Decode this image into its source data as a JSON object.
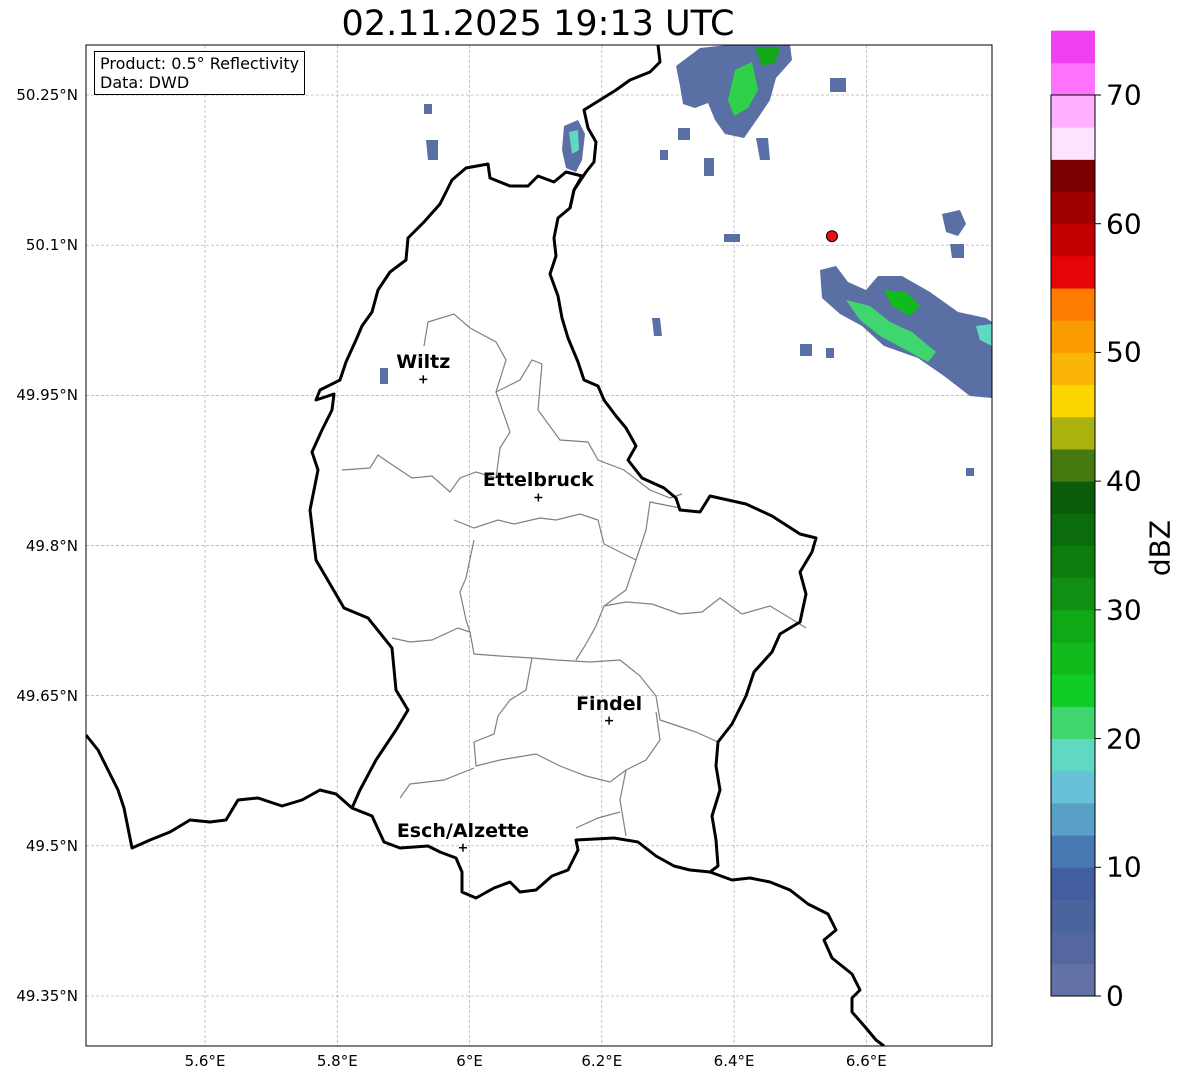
{
  "title": "02.11.2025 19:13 UTC",
  "info_box": {
    "product": "Product: 0.5° Reflectivity",
    "data": "Data: DWD"
  },
  "lat_ticks": [
    {
      "lat": 50.25,
      "label": "50.25°N"
    },
    {
      "lat": 50.1,
      "label": "50.1°N"
    },
    {
      "lat": 49.95,
      "label": "49.95°N"
    },
    {
      "lat": 49.8,
      "label": "49.8°N"
    },
    {
      "lat": 49.65,
      "label": "49.65°N"
    },
    {
      "lat": 49.5,
      "label": "49.5°N"
    },
    {
      "lat": 49.35,
      "label": "49.35°N"
    }
  ],
  "lon_ticks": [
    {
      "lon": 5.6,
      "label": "5.6°E"
    },
    {
      "lon": 5.8,
      "label": "5.8°E"
    },
    {
      "lon": 6.0,
      "label": "6°E"
    },
    {
      "lon": 6.2,
      "label": "6.2°E"
    },
    {
      "lon": 6.4,
      "label": "6.4°E"
    },
    {
      "lon": 6.6,
      "label": "6.6°E"
    }
  ],
  "extent": {
    "lon_min": 5.42,
    "lon_max": 6.79,
    "lat_min": 49.3,
    "lat_max": 50.3
  },
  "cities": [
    {
      "name": "Wiltz",
      "lon": 5.93,
      "lat": 49.966
    },
    {
      "name": "Ettelbruck",
      "lon": 6.104,
      "lat": 49.848
    },
    {
      "name": "Findel",
      "lon": 6.211,
      "lat": 49.625
    },
    {
      "name": "Esch/Alzette",
      "lon": 5.99,
      "lat": 49.498
    }
  ],
  "radar_site": {
    "lon": 6.548,
    "lat": 50.109,
    "color": "#e81010"
  },
  "colorbar": {
    "label": "dBZ",
    "min": 0,
    "max": 70,
    "step": 2.5,
    "tick_labels": [
      "0",
      "10",
      "20",
      "30",
      "40",
      "50",
      "60",
      "70"
    ],
    "colors": [
      "#6372a6",
      "#5567a0",
      "#4a649d",
      "#435da1",
      "#4879b3",
      "#58a0c6",
      "#67c1d7",
      "#5fd9c2",
      "#3fd56f",
      "#10cc27",
      "#10bb1b",
      "#10a815",
      "#118f13",
      "#0e7d0f",
      "#0b6c0d",
      "#0a5b0a",
      "#467a10",
      "#a9b20f",
      "#fdd600",
      "#fbb507",
      "#fa9b00",
      "#fe7d00",
      "#e50506",
      "#c20000",
      "#9f0000",
      "#780000",
      "#ffe2ff",
      "#ffb0ff",
      "#fe72fd",
      "#ef3ff0"
    ]
  }
}
